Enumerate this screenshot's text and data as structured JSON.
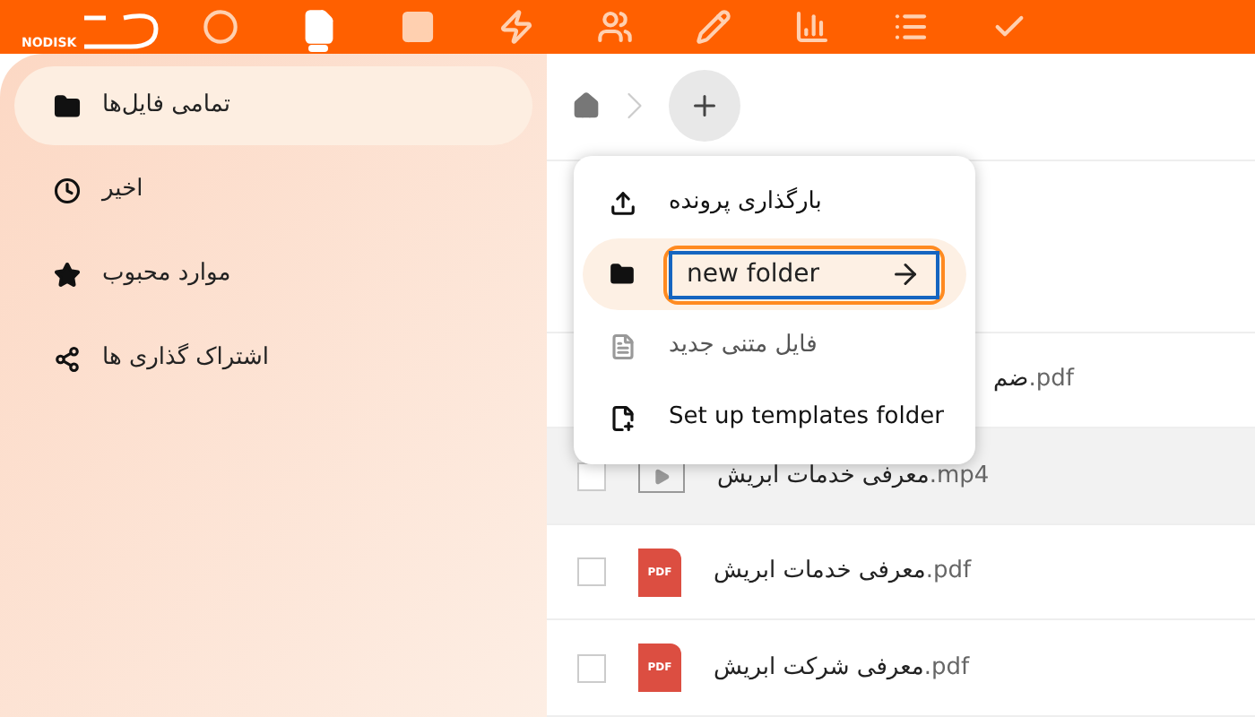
{
  "header": {
    "logo_text": "NODISK",
    "apps": [
      {
        "selected": false
      },
      {
        "selected": true
      },
      {
        "selected": false
      },
      {
        "selected": false
      },
      {
        "selected": false
      },
      {
        "selected": false
      },
      {
        "selected": false
      },
      {
        "selected": false
      },
      {
        "selected": false
      }
    ]
  },
  "sidebar": {
    "items": [
      {
        "label": "تمامی فایل‌ها",
        "selected": true
      },
      {
        "label": "اخیر",
        "selected": false
      },
      {
        "label": "موارد محبوب",
        "selected": false
      },
      {
        "label": "اشتراک گذاری ها",
        "selected": false
      }
    ]
  },
  "new_menu": {
    "items": [
      {
        "kind": "action",
        "label": "بارگذاری پرونده",
        "disabled": false
      },
      {
        "kind": "input",
        "value": "new folder"
      },
      {
        "kind": "action",
        "label": "فایل متنی جدید",
        "disabled": true
      },
      {
        "kind": "action",
        "label": "Set up templates folder",
        "disabled": false
      }
    ]
  },
  "files": [
    {
      "kind": "covered",
      "name": "ضم",
      "ext": ".pdf",
      "hovered": false
    },
    {
      "kind": "video",
      "name": "معرفی خدمات ابریش",
      "ext": ".mp4",
      "hovered": true
    },
    {
      "kind": "pdf",
      "badge": "PDF",
      "name": "معرفی خدمات ابریش",
      "ext": ".pdf",
      "hovered": false
    },
    {
      "kind": "pdf",
      "badge": "PDF",
      "name": "معرفی شرکت ابریش",
      "ext": ".pdf",
      "hovered": false
    }
  ]
}
